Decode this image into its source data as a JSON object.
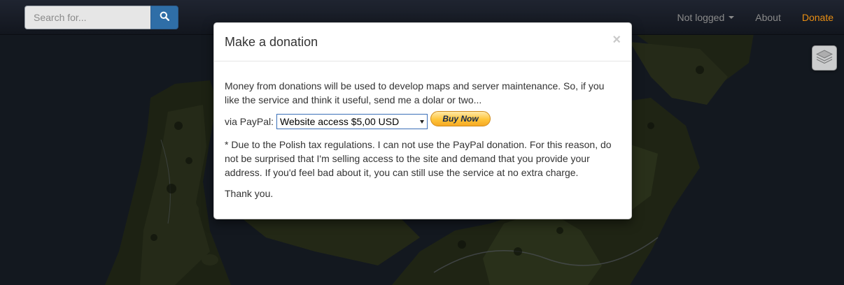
{
  "navbar": {
    "search_placeholder": "Search for...",
    "login_label": "Not logged",
    "about_label": "About",
    "donate_label": "Donate"
  },
  "modal": {
    "title": "Make a donation",
    "close_symbol": "×",
    "intro": "Money from donations will be used to develop maps and server maintenance. So, if you like the service and think it useful, send me a dolar or two...",
    "paypal_label": "via PayPal:",
    "selected_option": "Website access $5,00 USD",
    "buy_now_label": "Buy Now",
    "tax_notice": "* Due to the Polish tax regulations. I can not use the PayPal donation. For this reason, do not be surprised that I'm selling access to the site and demand that you provide your address. If you'd feel bad about it, you can still use the service at no extra charge.",
    "thanks": "Thank you."
  },
  "colors": {
    "accent": "#2f6ea7",
    "donate": "#e98e13",
    "land": "#4a5a2a",
    "sea": "#2a3648"
  },
  "icons": [
    "search-icon",
    "layers-icon",
    "close-icon",
    "caret-down-icon"
  ]
}
